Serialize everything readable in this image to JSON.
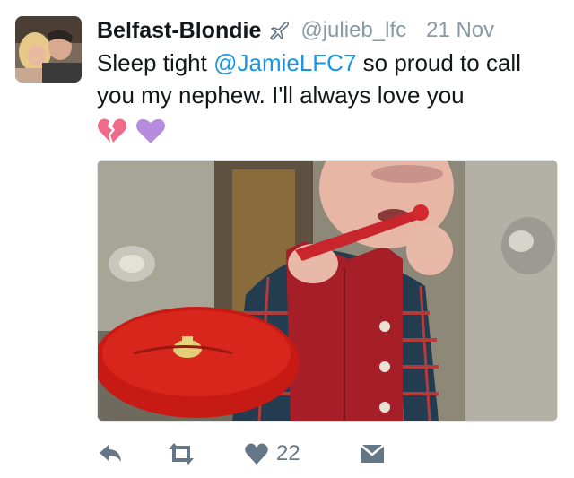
{
  "tweet": {
    "display_name": "Belfast-Blondie",
    "handle": "@julieb_lfc",
    "timestamp": "21 Nov",
    "text_before": "Sleep tight ",
    "mention": "@JamieLFC7",
    "text_after": " so proud to call you my nephew. I'll always love you",
    "emojis": [
      "broken-heart-icon",
      "purple-heart-icon"
    ],
    "media_alt": ""
  },
  "actions": {
    "like_count": "22"
  },
  "colors": {
    "handle_gray": "#8899a6",
    "mention_blue": "#1b95e0",
    "action_gray": "#657786",
    "broken_heart": "#f06a8a",
    "purple_heart": "#b78bde"
  },
  "icons": {
    "reply": "reply-arrow-icon",
    "retweet": "retweet-icon",
    "like": "heart-icon",
    "dm": "envelope-icon",
    "verified": "airplane-icon"
  }
}
